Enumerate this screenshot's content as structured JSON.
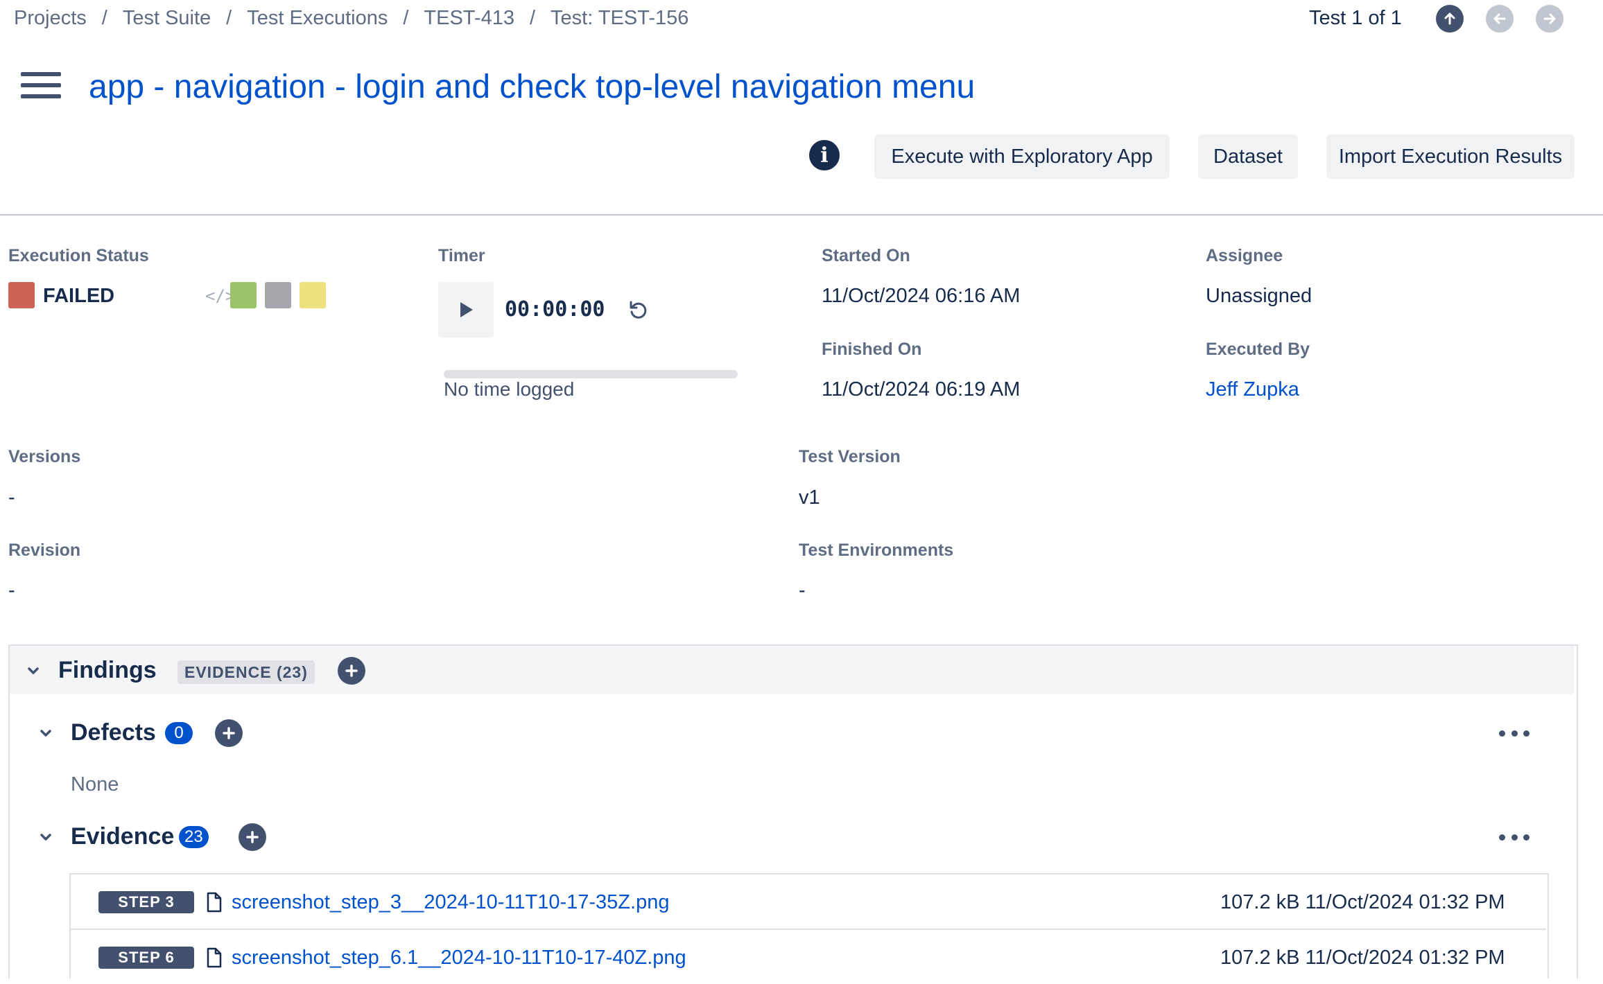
{
  "breadcrumb": [
    "Projects",
    "Test Suite",
    "Test Executions",
    "TEST-413",
    "Test: TEST-156"
  ],
  "breadcrumb_separator": "/",
  "pager": {
    "text": "Test 1 of 1",
    "icons": [
      "arrow-up-icon",
      "arrow-left-icon",
      "arrow-right-icon"
    ]
  },
  "title": "app - navigation - login and check top-level navigation menu",
  "actions": {
    "info_glyph": "i",
    "execute": "Execute with Exploratory App",
    "dataset": "Dataset",
    "import": "Import Execution Results"
  },
  "execution_status": {
    "label": "Execution Status",
    "value": "FAILED",
    "code_glyph": "</>",
    "colors": {
      "failed": "#cd6357",
      "passed": "#9bc36a",
      "todo": "#a5a7ad",
      "executing": "#ede27e"
    }
  },
  "timer": {
    "label": "Timer",
    "display": "00:00:00",
    "logged": "No time logged",
    "progress": 0
  },
  "started_on": {
    "label": "Started On",
    "value": "11/Oct/2024 06:16 AM"
  },
  "finished_on": {
    "label": "Finished On",
    "value": "11/Oct/2024 06:19 AM"
  },
  "assignee": {
    "label": "Assignee",
    "value": "Unassigned"
  },
  "executed_by": {
    "label": "Executed By",
    "value": "Jeff Zupka"
  },
  "versions": {
    "label": "Versions",
    "value": "-"
  },
  "test_version": {
    "label": "Test Version",
    "value": "v1"
  },
  "revision": {
    "label": "Revision",
    "value": "-"
  },
  "test_environments": {
    "label": "Test Environments",
    "value": "-"
  },
  "findings": {
    "title": "Findings",
    "badge": "EVIDENCE (23)",
    "defects": {
      "title": "Defects",
      "count": "0",
      "empty": "None"
    },
    "evidence": {
      "title": "Evidence",
      "count": "23",
      "items": [
        {
          "step": "STEP 3",
          "file": "screenshot_step_3__2024-10-11T10-17-35Z.png",
          "size": "107.2 kB",
          "date": "11/Oct/2024 01:32 PM"
        },
        {
          "step": "STEP 6",
          "file": "screenshot_step_6.1__2024-10-11T10-17-40Z.png",
          "size": "107.2 kB",
          "date": "11/Oct/2024 01:32 PM"
        }
      ]
    }
  }
}
